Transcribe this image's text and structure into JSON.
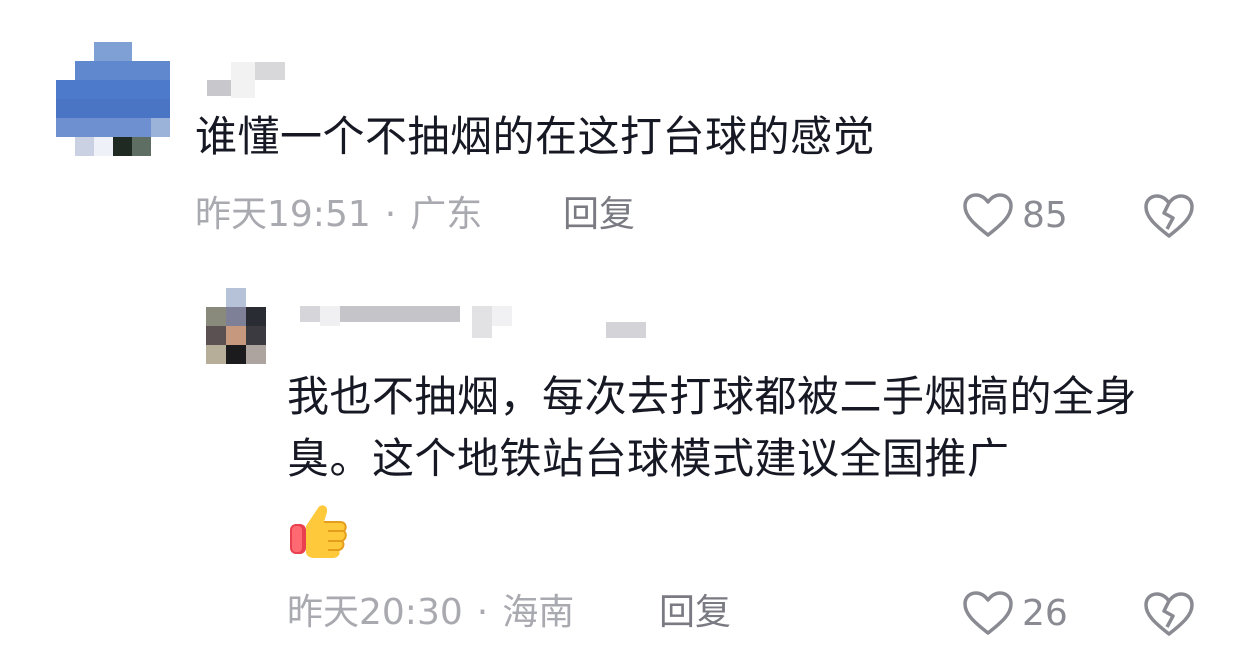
{
  "comments": [
    {
      "text": "谁懂一个不抽烟的在这打台球的感觉",
      "time": "昨天19:51",
      "location": "广东",
      "reply_label": "回复",
      "like_count": "85",
      "icons": {
        "like": "heart-outline-icon",
        "dislike": "broken-heart-icon"
      }
    },
    {
      "text": "我也不抽烟，每次去打球都被二手烟搞的全身臭。这个地铁站台球模式建议全国推广",
      "emoji": "thumbs-up-emoji",
      "time": "昨天20:30",
      "location": "海南",
      "reply_label": "回复",
      "like_count": "26",
      "icons": {
        "like": "heart-outline-icon",
        "dislike": "broken-heart-icon"
      }
    }
  ],
  "colors": {
    "text": "#161823",
    "meta": "#a9a9b0",
    "reply": "#7a7a82",
    "icon": "#8a8a92"
  }
}
